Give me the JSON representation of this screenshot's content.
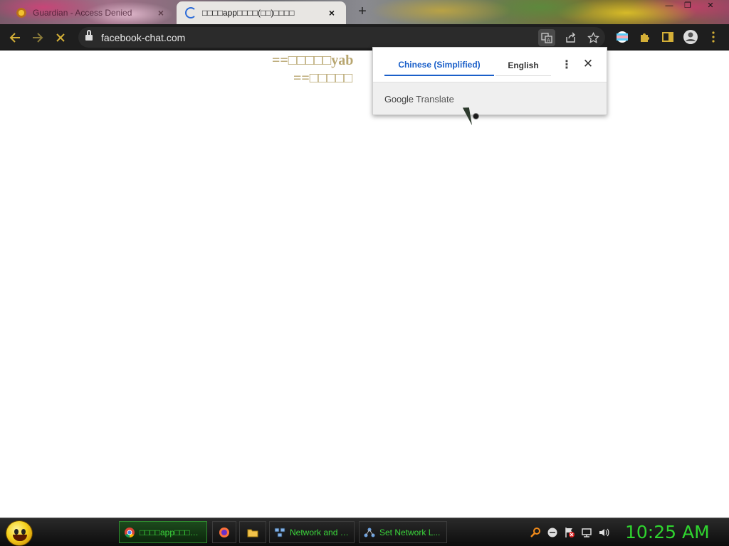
{
  "tabs": [
    {
      "title": "Guardian - Access Denied",
      "active": false
    },
    {
      "title": "□□□□app□□□□(□□)□□□□",
      "active": true
    }
  ],
  "toolbar": {
    "url": "facebook-chat.com",
    "back_icon": "arrow-left-icon",
    "forward_icon": "arrow-right-icon",
    "stop_icon": "close-icon"
  },
  "page": {
    "line1": "==□□□□□yab",
    "line2": "==□□□□□"
  },
  "translate_popup": {
    "tab_source": "Chinese (Simplified)",
    "tab_target": "English",
    "brand_google": "Google",
    "brand_product": "Translate",
    "active_color": "#1a5fc9"
  },
  "taskbar": {
    "items": [
      {
        "label": "□□□□app□□□□(□□)□□□..."
      },
      {
        "label": ""
      },
      {
        "label": ""
      },
      {
        "label": "Network and S..."
      },
      {
        "label": "Set Network L..."
      }
    ],
    "clock": "10:25 AM"
  },
  "colors": {
    "accent": "#d4af37",
    "taskbar_text": "#3bd63b"
  }
}
